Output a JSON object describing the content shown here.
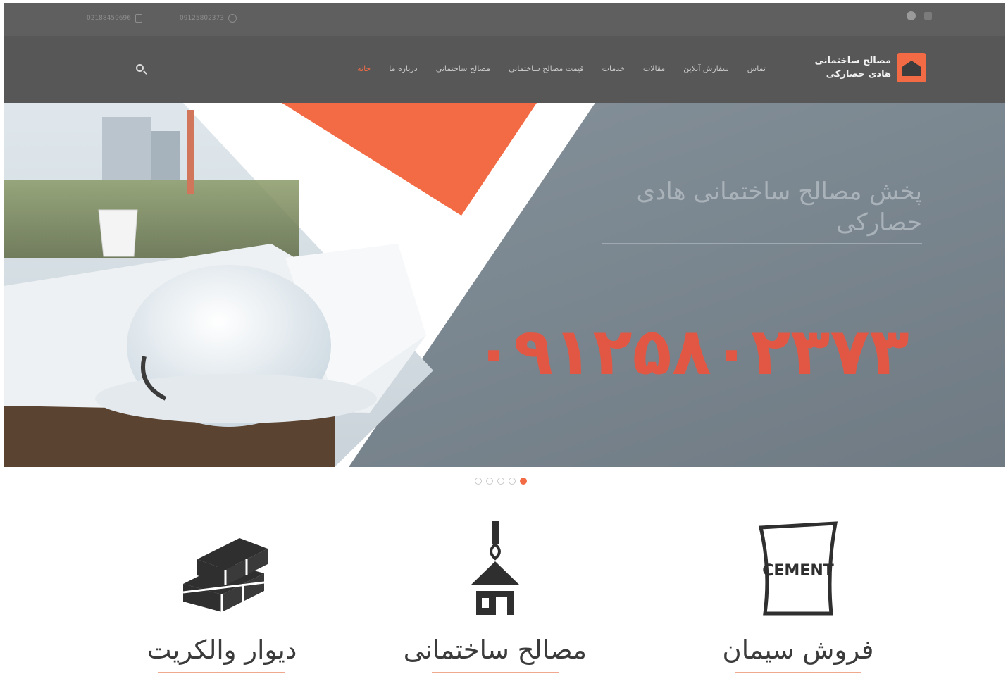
{
  "topbar": {
    "contacts": [
      {
        "icon": "phone-icon",
        "text": "02188459696"
      },
      {
        "icon": "headset-icon",
        "text": "09125802373"
      }
    ],
    "social_icons": [
      "instagram-icon",
      "menu-icon"
    ]
  },
  "nav": {
    "logo_line1": "مصالح ساختمانی",
    "logo_line2": "هادی حصارکی",
    "menu": [
      "خانه",
      "درباره ما",
      "مصالح ساختمانی",
      "قیمت مصالح ساختمانی",
      "خدمات",
      "مقالات",
      "سفارش آنلاین",
      "تماس"
    ],
    "active_index": 0
  },
  "slider": {
    "title": "پخش مصالح ساختمانی هادی حصارکی",
    "phone": "۰۹۱۲۵۸۰۲۳۷۳",
    "slide_count": 5,
    "active_slide": 4
  },
  "features": [
    {
      "icon": "cement-bag-icon",
      "title": "فروش سیمان"
    },
    {
      "icon": "crane-house-icon",
      "title": "مصالح ساختمانی"
    },
    {
      "icon": "bricks-icon",
      "title": "دیوار والکریت"
    }
  ],
  "colors": {
    "accent": "#f26b45",
    "topbar": "#5f5f5f",
    "navbar": "#575757"
  }
}
